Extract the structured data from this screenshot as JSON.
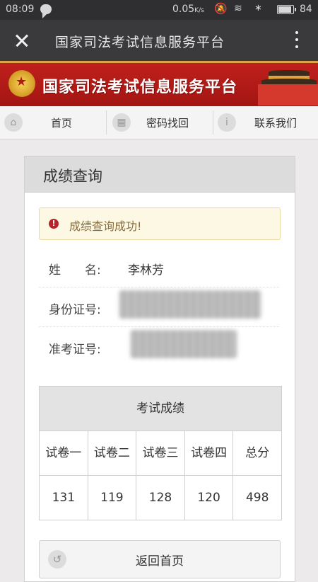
{
  "status_bar": {
    "time": "08:09",
    "speed": "0.05",
    "speed_unit": "K/s",
    "battery": "84"
  },
  "app_bar": {
    "title": "国家司法考试信息服务平台"
  },
  "banner": {
    "site_name": "国家司法考试信息服务平台",
    "colors": {
      "banner_red": "#c0201c",
      "gold": "#d9a545"
    }
  },
  "nav": {
    "items": [
      {
        "label": "首页",
        "icon": "home-icon"
      },
      {
        "label": "密码找回",
        "icon": "grid-icon"
      },
      {
        "label": "联系我们",
        "icon": "info-icon"
      }
    ]
  },
  "panel": {
    "title": "成绩查询",
    "alert": "成绩查询成功!",
    "fields": {
      "name_label": "姓　　名:",
      "name_value": "李林芳",
      "id_label": "身份证号:",
      "exam_no_label": "准考证号:"
    },
    "score_table": {
      "caption": "考试成绩",
      "headers": [
        "试卷一",
        "试卷二",
        "试卷三",
        "试卷四",
        "总分"
      ],
      "values": [
        "131",
        "119",
        "128",
        "120",
        "498"
      ]
    },
    "back_button": "返回首页"
  }
}
